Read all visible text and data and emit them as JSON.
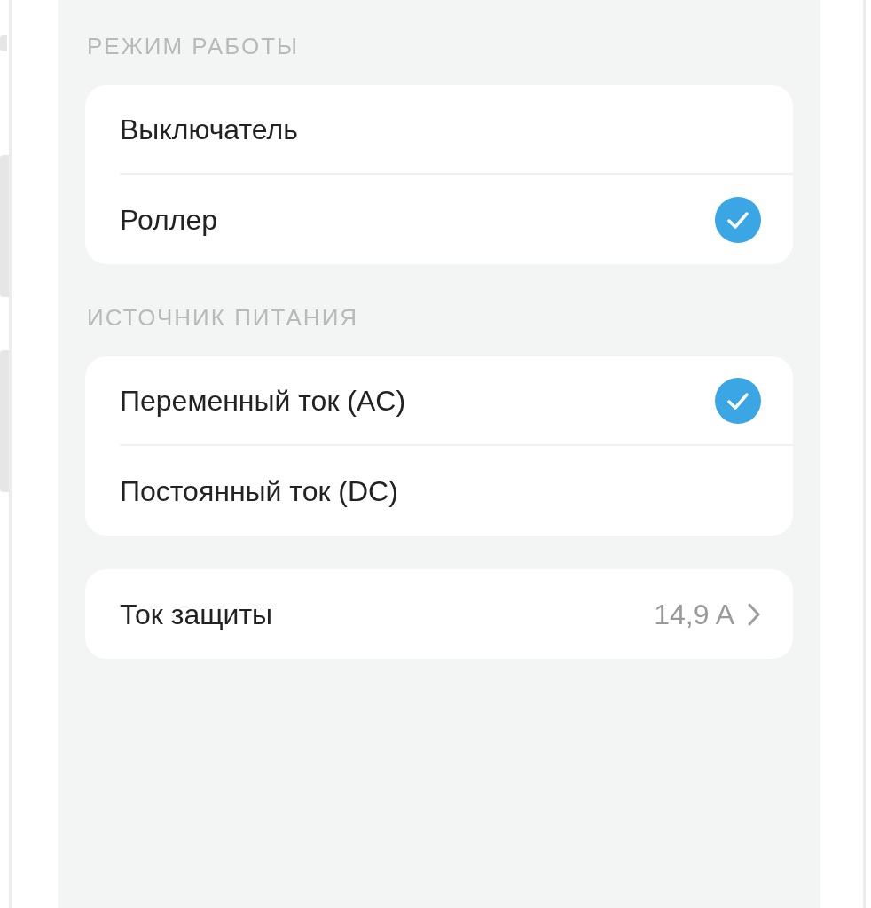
{
  "sections": [
    {
      "header": "РЕЖИМ РАБОТЫ",
      "rows": [
        {
          "kind": "option",
          "label": "Выключатель",
          "selected": false
        },
        {
          "kind": "option",
          "label": "Роллер",
          "selected": true
        }
      ]
    },
    {
      "header": "ИСТОЧНИК ПИТАНИЯ",
      "rows": [
        {
          "kind": "option",
          "label": "Переменный ток (AC)",
          "selected": true
        },
        {
          "kind": "option",
          "label": "Постоянный ток (DC)",
          "selected": false
        }
      ]
    },
    {
      "rows": [
        {
          "kind": "value",
          "label": "Ток защиты",
          "value": "14,9 A"
        }
      ]
    }
  ]
}
